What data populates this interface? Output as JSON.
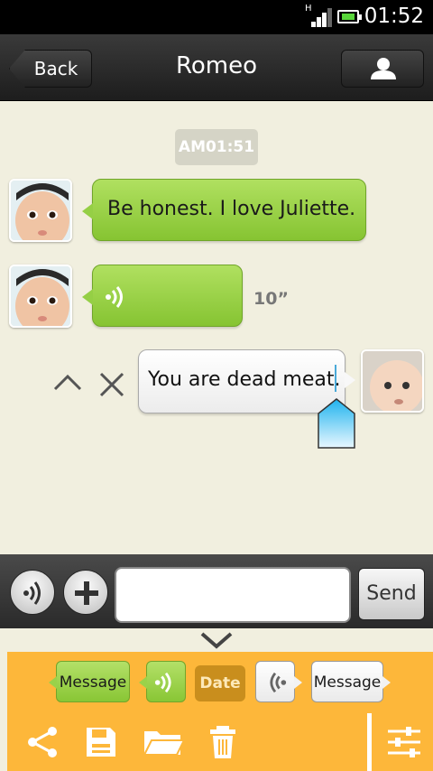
{
  "status_bar": {
    "time": "01:52",
    "network": "H"
  },
  "header": {
    "back_label": "Back",
    "title": "Romeo"
  },
  "chat": {
    "time_badge": "AM01:51",
    "messages": [
      {
        "sender": "them",
        "type": "text",
        "text": "Be honest. I love Juliette."
      },
      {
        "sender": "them",
        "type": "voice",
        "duration": "10”"
      },
      {
        "sender": "me",
        "type": "text",
        "text": "You are dead meat."
      }
    ]
  },
  "composer": {
    "input_value": "",
    "send_label": "Send"
  },
  "legend": {
    "items": [
      {
        "label": "Message",
        "style": "green-bubble"
      },
      {
        "icon": "voice-wave-icon",
        "style": "green-bubble"
      },
      {
        "label": "Date",
        "style": "date-badge"
      },
      {
        "icon": "voice-wave-icon",
        "style": "white-bubble"
      },
      {
        "label": "Message",
        "style": "white-bubble"
      }
    ]
  },
  "toolbar": {
    "icons": [
      "share-icon",
      "save-icon",
      "folder-icon",
      "trash-icon",
      "settings-sliders-icon"
    ]
  },
  "colors": {
    "chat_background": "#f1efdf",
    "header": "#2b2b2b",
    "incoming_bubble": "#95cf45",
    "outgoing_bubble": "#ffffff",
    "panel": "#fdb73a",
    "date_badge": "#c98e1d"
  }
}
